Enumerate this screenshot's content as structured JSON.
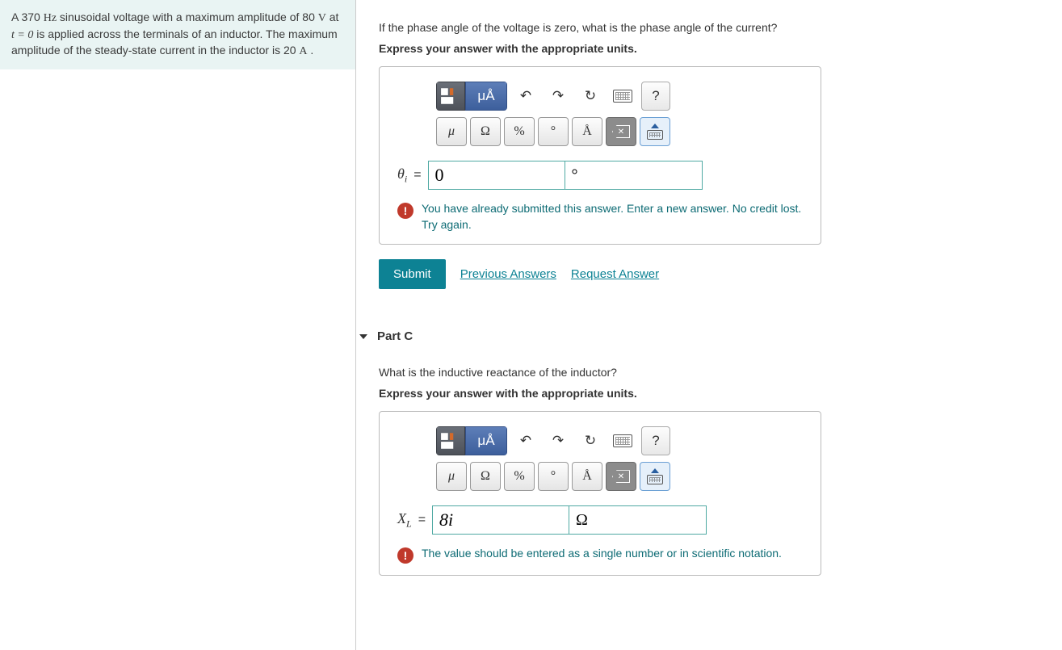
{
  "problem": {
    "text_parts": [
      "A 370 ",
      "Hz",
      " sinusoidal voltage with a maximum amplitude of 80 ",
      "V",
      " at ",
      "t = 0",
      " is applied across the terminals of an inductor. The maximum amplitude of the steady-state current in the inductor is 20 ",
      "A",
      " ."
    ]
  },
  "partB": {
    "question": "If the phase angle of the voltage is zero, what is the phase angle of the current?",
    "instruction": "Express your answer with the appropriate units.",
    "toolbar": {
      "units_btn": "μÅ",
      "help": "?"
    },
    "symbols": {
      "mu": "μ",
      "omega": "Ω",
      "percent": "%",
      "degree": "°",
      "angstrom": "Å"
    },
    "var_html": "θ<sub>i</sub>",
    "equals": "=",
    "value": "0",
    "unit": "°",
    "feedback": "You have already submitted this answer. Enter a new answer. No credit lost. Try again.",
    "submit": "Submit",
    "prev": "Previous Answers",
    "req": "Request Answer"
  },
  "partC": {
    "title": "Part C",
    "question": "What is the inductive reactance of the inductor?",
    "instruction": "Express your answer with the appropriate units.",
    "toolbar": {
      "units_btn": "μÅ",
      "help": "?"
    },
    "symbols": {
      "mu": "μ",
      "omega": "Ω",
      "percent": "%",
      "degree": "°",
      "angstrom": "Å"
    },
    "var_html": "X<sub>L</sub>",
    "equals": "=",
    "value": "8i",
    "unit": "Ω",
    "feedback": "The value should be entered as a single number or in scientific notation."
  }
}
